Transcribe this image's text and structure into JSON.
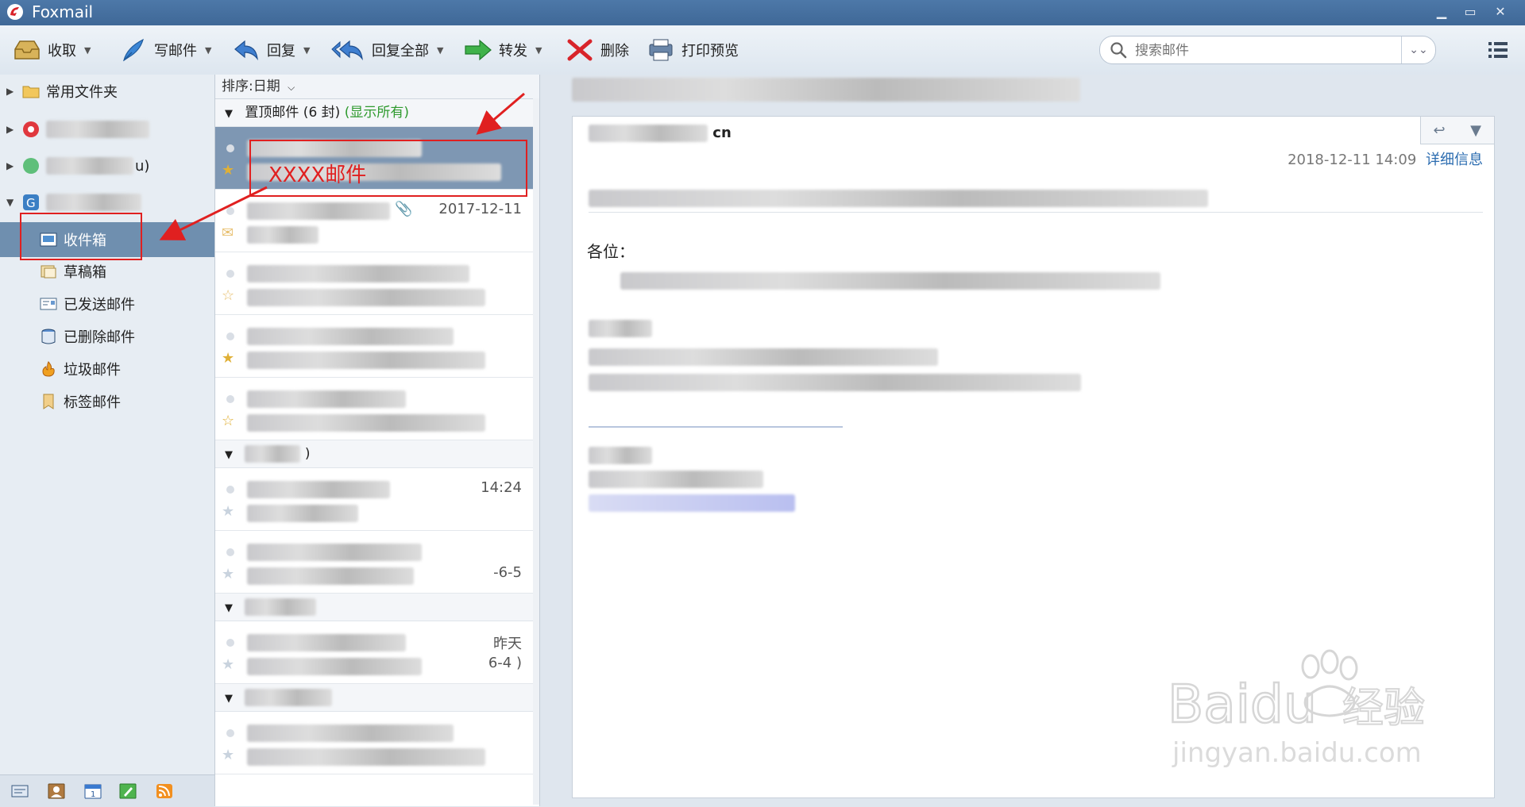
{
  "window": {
    "title": "Foxmail",
    "minimize": "▁",
    "restore": "▭",
    "close": "✕"
  },
  "toolbar": {
    "receive": "收取",
    "compose": "写邮件",
    "reply": "回复",
    "reply_all": "回复全部",
    "forward": "转发",
    "delete": "删除",
    "print_preview": "打印预览"
  },
  "search": {
    "placeholder": "搜索邮件",
    "value": ""
  },
  "sidebar": {
    "items": [
      {
        "label": "常用文件夹"
      },
      {
        "label": "收件箱"
      },
      {
        "label": "草稿箱"
      },
      {
        "label": "已发送邮件"
      },
      {
        "label": "已删除邮件"
      },
      {
        "label": "垃圾邮件"
      },
      {
        "label": "标签邮件"
      }
    ],
    "partial_account": "u)"
  },
  "list": {
    "sort_label": "排序:日期",
    "pinned_group": "置顶邮件 (6 封)",
    "show_all": "(显示所有)",
    "rows": [
      {
        "time": ""
      },
      {
        "time": "2017-12-11"
      },
      {
        "time": ""
      },
      {
        "time": ""
      },
      {
        "time": ""
      },
      {
        "time": "14:24"
      },
      {
        "time": "-6-5"
      },
      {
        "time": "昨天"
      },
      {
        "time": ""
      }
    ],
    "row7_extra": "6-4 )",
    "group2_tail": ")"
  },
  "reading": {
    "sender_suffix": "cn",
    "datetime": "2018-12-11 14:09",
    "details": "详细信息",
    "greeting": "各位："
  },
  "annotation": {
    "label": "XXXX邮件",
    "color": "#e02020"
  },
  "watermark": {
    "brand": "Baidu",
    "cn": "经验",
    "url": "jingyan.baidu.com"
  }
}
